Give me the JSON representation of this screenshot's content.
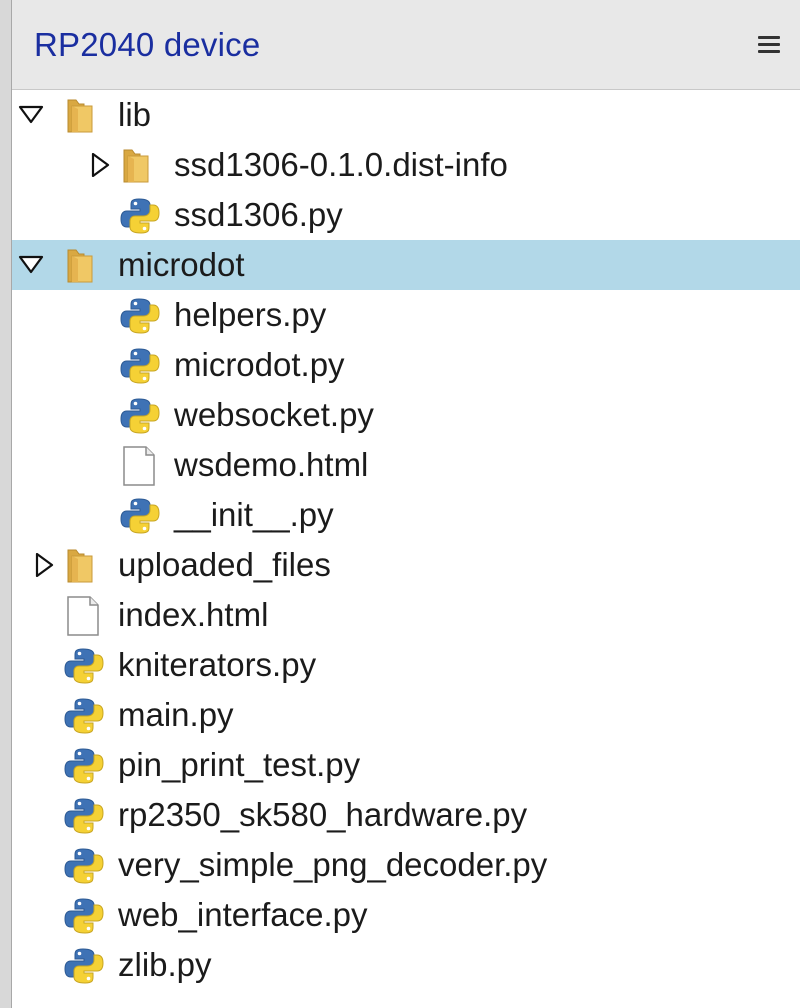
{
  "header": {
    "title": "RP2040 device",
    "menu_icon": "hamburger-menu-icon"
  },
  "colors": {
    "title": "#1a2ea0",
    "selection": "#b2d8e8",
    "folder": "#e8bb55",
    "python_blue": "#3e72b5",
    "python_yellow": "#f5d135"
  },
  "tree": {
    "items": [
      {
        "label": "lib",
        "type": "folder",
        "expanded": true
      },
      {
        "label": "ssd1306-0.1.0.dist-info",
        "type": "folder",
        "expanded": false
      },
      {
        "label": "ssd1306.py",
        "type": "python"
      },
      {
        "label": "microdot",
        "type": "folder",
        "expanded": true,
        "selected": true
      },
      {
        "label": "helpers.py",
        "type": "python"
      },
      {
        "label": "microdot.py",
        "type": "python"
      },
      {
        "label": "websocket.py",
        "type": "python"
      },
      {
        "label": "wsdemo.html",
        "type": "file"
      },
      {
        "label": "__init__.py",
        "type": "python"
      },
      {
        "label": "uploaded_files",
        "type": "folder",
        "expanded": false
      },
      {
        "label": "index.html",
        "type": "file"
      },
      {
        "label": "kniterators.py",
        "type": "python"
      },
      {
        "label": "main.py",
        "type": "python"
      },
      {
        "label": "pin_print_test.py",
        "type": "python"
      },
      {
        "label": "rp2350_sk580_hardware.py",
        "type": "python"
      },
      {
        "label": "very_simple_png_decoder.py",
        "type": "python"
      },
      {
        "label": "web_interface.py",
        "type": "python"
      },
      {
        "label": "zlib.py",
        "type": "python"
      }
    ]
  }
}
